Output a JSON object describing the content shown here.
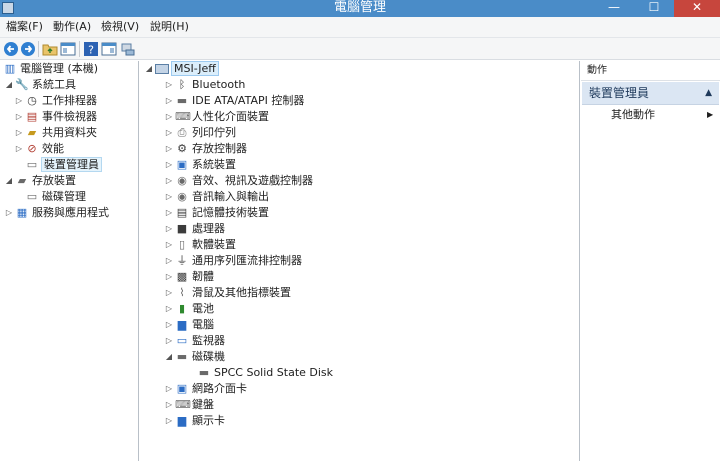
{
  "window": {
    "title": "電腦管理",
    "minimize_glyph": "—",
    "maximize_glyph": "☐",
    "close_glyph": "✕"
  },
  "menu": {
    "items": [
      {
        "label": "檔案(F)"
      },
      {
        "label": "動作(A)"
      },
      {
        "label": "檢視(V)"
      },
      {
        "label": "說明(H)"
      }
    ]
  },
  "toolbar": {
    "icons": [
      "back-icon",
      "forward-icon",
      "folder-up-icon",
      "show-hide-tree-icon",
      "help-icon",
      "properties-icon",
      "device-manager-icon"
    ]
  },
  "left_tree": {
    "root": {
      "label": "電腦管理 (本機)",
      "icon": "computer-management-icon"
    },
    "items": [
      {
        "label": "系統工具",
        "expander": "◢",
        "icon": "tools-icon",
        "glyph": "🔧"
      },
      {
        "label": "工作排程器",
        "expander": "▷",
        "icon": "clock-icon",
        "glyph": "◷"
      },
      {
        "label": "事件檢視器",
        "expander": "▷",
        "icon": "event-viewer-icon",
        "glyph": "▤"
      },
      {
        "label": "共用資料夾",
        "expander": "▷",
        "icon": "shared-folder-icon",
        "glyph": "▰"
      },
      {
        "label": "效能",
        "expander": "▷",
        "icon": "performance-icon",
        "glyph": "⊘"
      },
      {
        "label": "裝置管理員",
        "expander": "",
        "icon": "device-manager-icon",
        "glyph": "▭"
      },
      {
        "label": "存放裝置",
        "expander": "◢",
        "icon": "storage-icon",
        "glyph": "▰"
      },
      {
        "label": "磁碟管理",
        "expander": "",
        "icon": "disk-management-icon",
        "glyph": "▭"
      },
      {
        "label": "服務與應用程式",
        "expander": "▷",
        "icon": "services-icon",
        "glyph": "▦"
      }
    ]
  },
  "device_tree": {
    "root": {
      "label": "MSI-Jeff",
      "expander": "◢",
      "icon": "computer-icon"
    },
    "items": [
      {
        "label": "Bluetooth",
        "expander": "▷",
        "icon": "bluetooth-icon",
        "glyph": "ᛒ"
      },
      {
        "label": "IDE ATA/ATAPI 控制器",
        "expander": "▷",
        "icon": "ide-controller-icon",
        "glyph": "▬"
      },
      {
        "label": "人性化介面裝置",
        "expander": "▷",
        "icon": "hid-icon",
        "glyph": "⌨"
      },
      {
        "label": "列印佇列",
        "expander": "▷",
        "icon": "printer-icon",
        "glyph": "⎙"
      },
      {
        "label": "存放控制器",
        "expander": "▷",
        "icon": "storage-controller-icon",
        "glyph": "⚙"
      },
      {
        "label": "系統裝置",
        "expander": "▷",
        "icon": "system-device-icon",
        "glyph": "▣"
      },
      {
        "label": "音效、視訊及遊戲控制器",
        "expander": "▷",
        "icon": "sound-icon",
        "glyph": "◉"
      },
      {
        "label": "音訊輸入與輸出",
        "expander": "▷",
        "icon": "audio-io-icon",
        "glyph": "◉"
      },
      {
        "label": "記憶體技術裝置",
        "expander": "▷",
        "icon": "memory-tech-icon",
        "glyph": "▤"
      },
      {
        "label": "處理器",
        "expander": "▷",
        "icon": "processor-icon",
        "glyph": "■"
      },
      {
        "label": "軟體裝置",
        "expander": "▷",
        "icon": "software-device-icon",
        "glyph": "▯"
      },
      {
        "label": "通用序列匯流排控制器",
        "expander": "▷",
        "icon": "usb-icon",
        "glyph": "⏚"
      },
      {
        "label": "韌體",
        "expander": "▷",
        "icon": "firmware-icon",
        "glyph": "▩"
      },
      {
        "label": "滑鼠及其他指標裝置",
        "expander": "▷",
        "icon": "mouse-icon",
        "glyph": "⌇"
      },
      {
        "label": "電池",
        "expander": "▷",
        "icon": "battery-icon",
        "glyph": "▮"
      },
      {
        "label": "電腦",
        "expander": "▷",
        "icon": "pc-icon",
        "glyph": "▆"
      },
      {
        "label": "監視器",
        "expander": "▷",
        "icon": "monitor-icon",
        "glyph": "▭"
      },
      {
        "label": "磁碟機",
        "expander": "◢",
        "icon": "disk-drive-icon",
        "glyph": "▬"
      },
      {
        "label": "SPCC Solid State Disk",
        "expander": "",
        "icon": "ssd-icon",
        "glyph": "▬"
      },
      {
        "label": "網路介面卡",
        "expander": "▷",
        "icon": "network-adapter-icon",
        "glyph": "▣"
      },
      {
        "label": "鍵盤",
        "expander": "▷",
        "icon": "keyboard-icon",
        "glyph": "⌨"
      },
      {
        "label": "顯示卡",
        "expander": "▷",
        "icon": "display-adapter-icon",
        "glyph": "▆"
      }
    ]
  },
  "actions_pane": {
    "header": "動作",
    "group_title": "裝置管理員",
    "group_caret": "▲",
    "item": "其他動作",
    "item_arrow": "▶"
  },
  "colors": {
    "titlebar": "#4a8cc8",
    "close_button": "#c7463d",
    "selection": "#e5f3fb",
    "actions_group": "#dbe6f3"
  }
}
